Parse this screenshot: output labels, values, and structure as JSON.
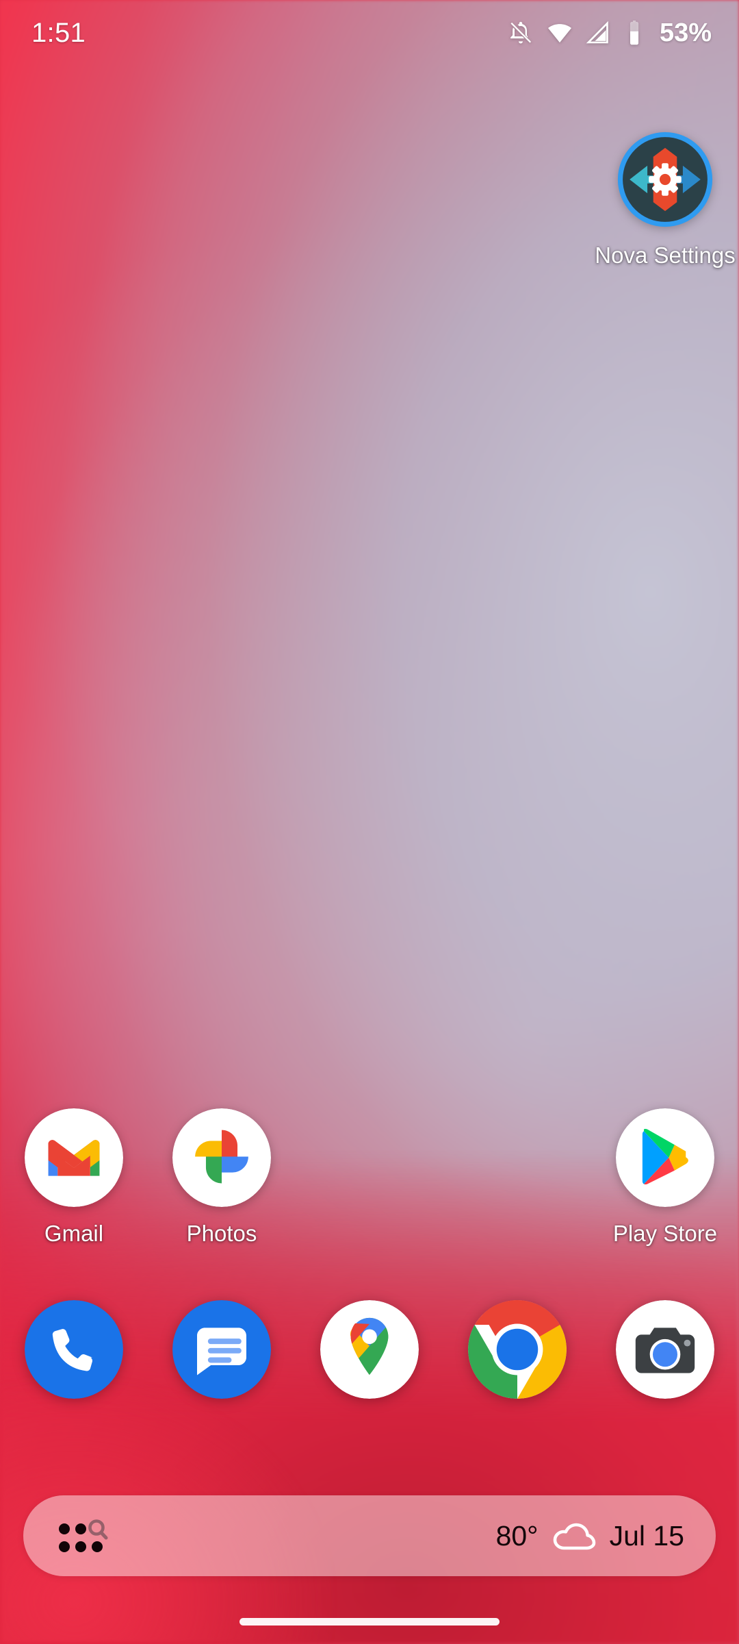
{
  "statusbar": {
    "time": "1:51",
    "battery_percent": "53%",
    "icons": [
      "notifications-silenced-icon",
      "wifi-icon",
      "cellular-signal-icon",
      "battery-icon"
    ]
  },
  "home": {
    "rows": [
      {
        "name": "nova-row",
        "cells": [
          {
            "empty": true
          },
          {
            "empty": true
          },
          {
            "empty": true
          },
          {
            "empty": true
          },
          {
            "empty": false,
            "icon": "nova-settings-icon",
            "label": "Nova Settings"
          }
        ]
      },
      {
        "name": "apps-row",
        "cells": [
          {
            "empty": false,
            "icon": "gmail-icon",
            "label": "Gmail"
          },
          {
            "empty": false,
            "icon": "photos-icon",
            "label": "Photos"
          },
          {
            "empty": true
          },
          {
            "empty": true
          },
          {
            "empty": false,
            "icon": "play-store-icon",
            "label": "Play Store"
          }
        ]
      }
    ],
    "dock": [
      {
        "icon": "phone-icon",
        "label": "Phone"
      },
      {
        "icon": "messages-icon",
        "label": "Messages"
      },
      {
        "icon": "maps-icon",
        "label": "Maps"
      },
      {
        "icon": "chrome-icon",
        "label": "Chrome"
      },
      {
        "icon": "camera-icon",
        "label": "Camera"
      }
    ]
  },
  "searchbar": {
    "drawer_icon": "app-drawer-search-icon",
    "temperature": "80°",
    "weather_icon": "cloud-icon",
    "date": "Jul 15"
  },
  "navbar": {
    "gesture_pill": "home-gesture-pill"
  },
  "colors": {
    "wallpaper_red": "#ee3450",
    "wallpaper_lavender": "#c2b6c8",
    "wallpaper_bottom_red": "#e62945",
    "search_pill": "rgba(255,255,255,0.46)",
    "status_text": "#ffffff",
    "label_text": "#ffffff",
    "search_text": "#14070a"
  }
}
